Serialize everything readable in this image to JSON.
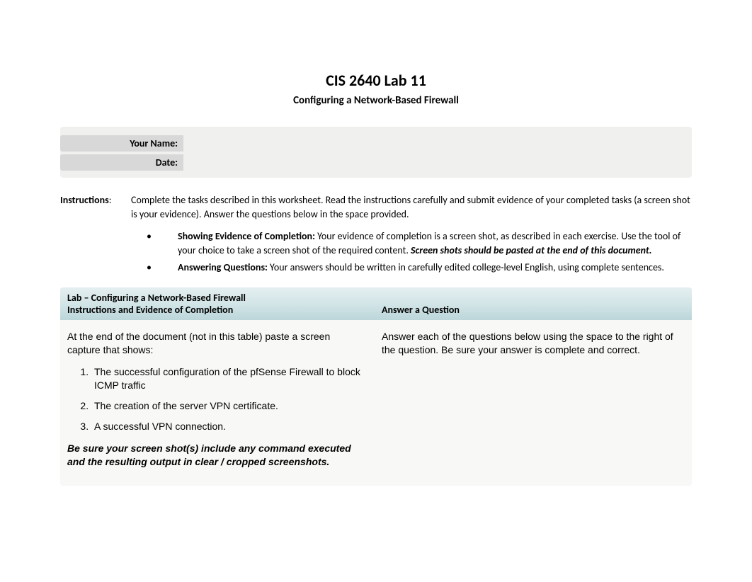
{
  "title": "CIS 2640 Lab 11",
  "subtitle": "Configuring a Network-Based Firewall",
  "info": {
    "name_label": "Your Name:",
    "name_value": "",
    "date_label": "Date:",
    "date_value": ""
  },
  "instructions": {
    "label": "Instructions",
    "colon": ":",
    "body": "Complete the tasks described in this worksheet. Read the instructions carefully and submit evidence of your completed tasks (a screen shot is your evidence). Answer the questions below in the space provided.",
    "bullets": {
      "b1_bold": "Showing Evidence of Completion:",
      "b1_rest": " Your evidence of completion is a screen shot, as described in each exercise. Use the tool of your choice to take a screen shot of the required content.  ",
      "b1_italic": "Screen shots should be pasted at the end of this document.",
      "b2_bold": "Answering Questions:",
      "b2_rest": " Your answers should be written in carefully edited college-level English, using complete sentences."
    }
  },
  "lab": {
    "title": "Lab – Configuring a Network-Based Firewall",
    "header_left": "Instructions and Evidence of Completion",
    "header_right": "Answer a Question",
    "left_intro": "At the end of the document (not in this table) paste a screen capture that shows:",
    "tasks": {
      "t1": "The successful configuration of the pfSense Firewall to block ICMP traffic",
      "t2": "The creation of the server VPN certificate.",
      "t3": "A successful VPN connection."
    },
    "left_note": "Be sure your screen shot(s) include any command executed and the resulting output in clear / cropped screenshots.",
    "right_intro": "Answer each of the questions below using the space to the right of the question.  Be sure your answer is complete and correct."
  }
}
